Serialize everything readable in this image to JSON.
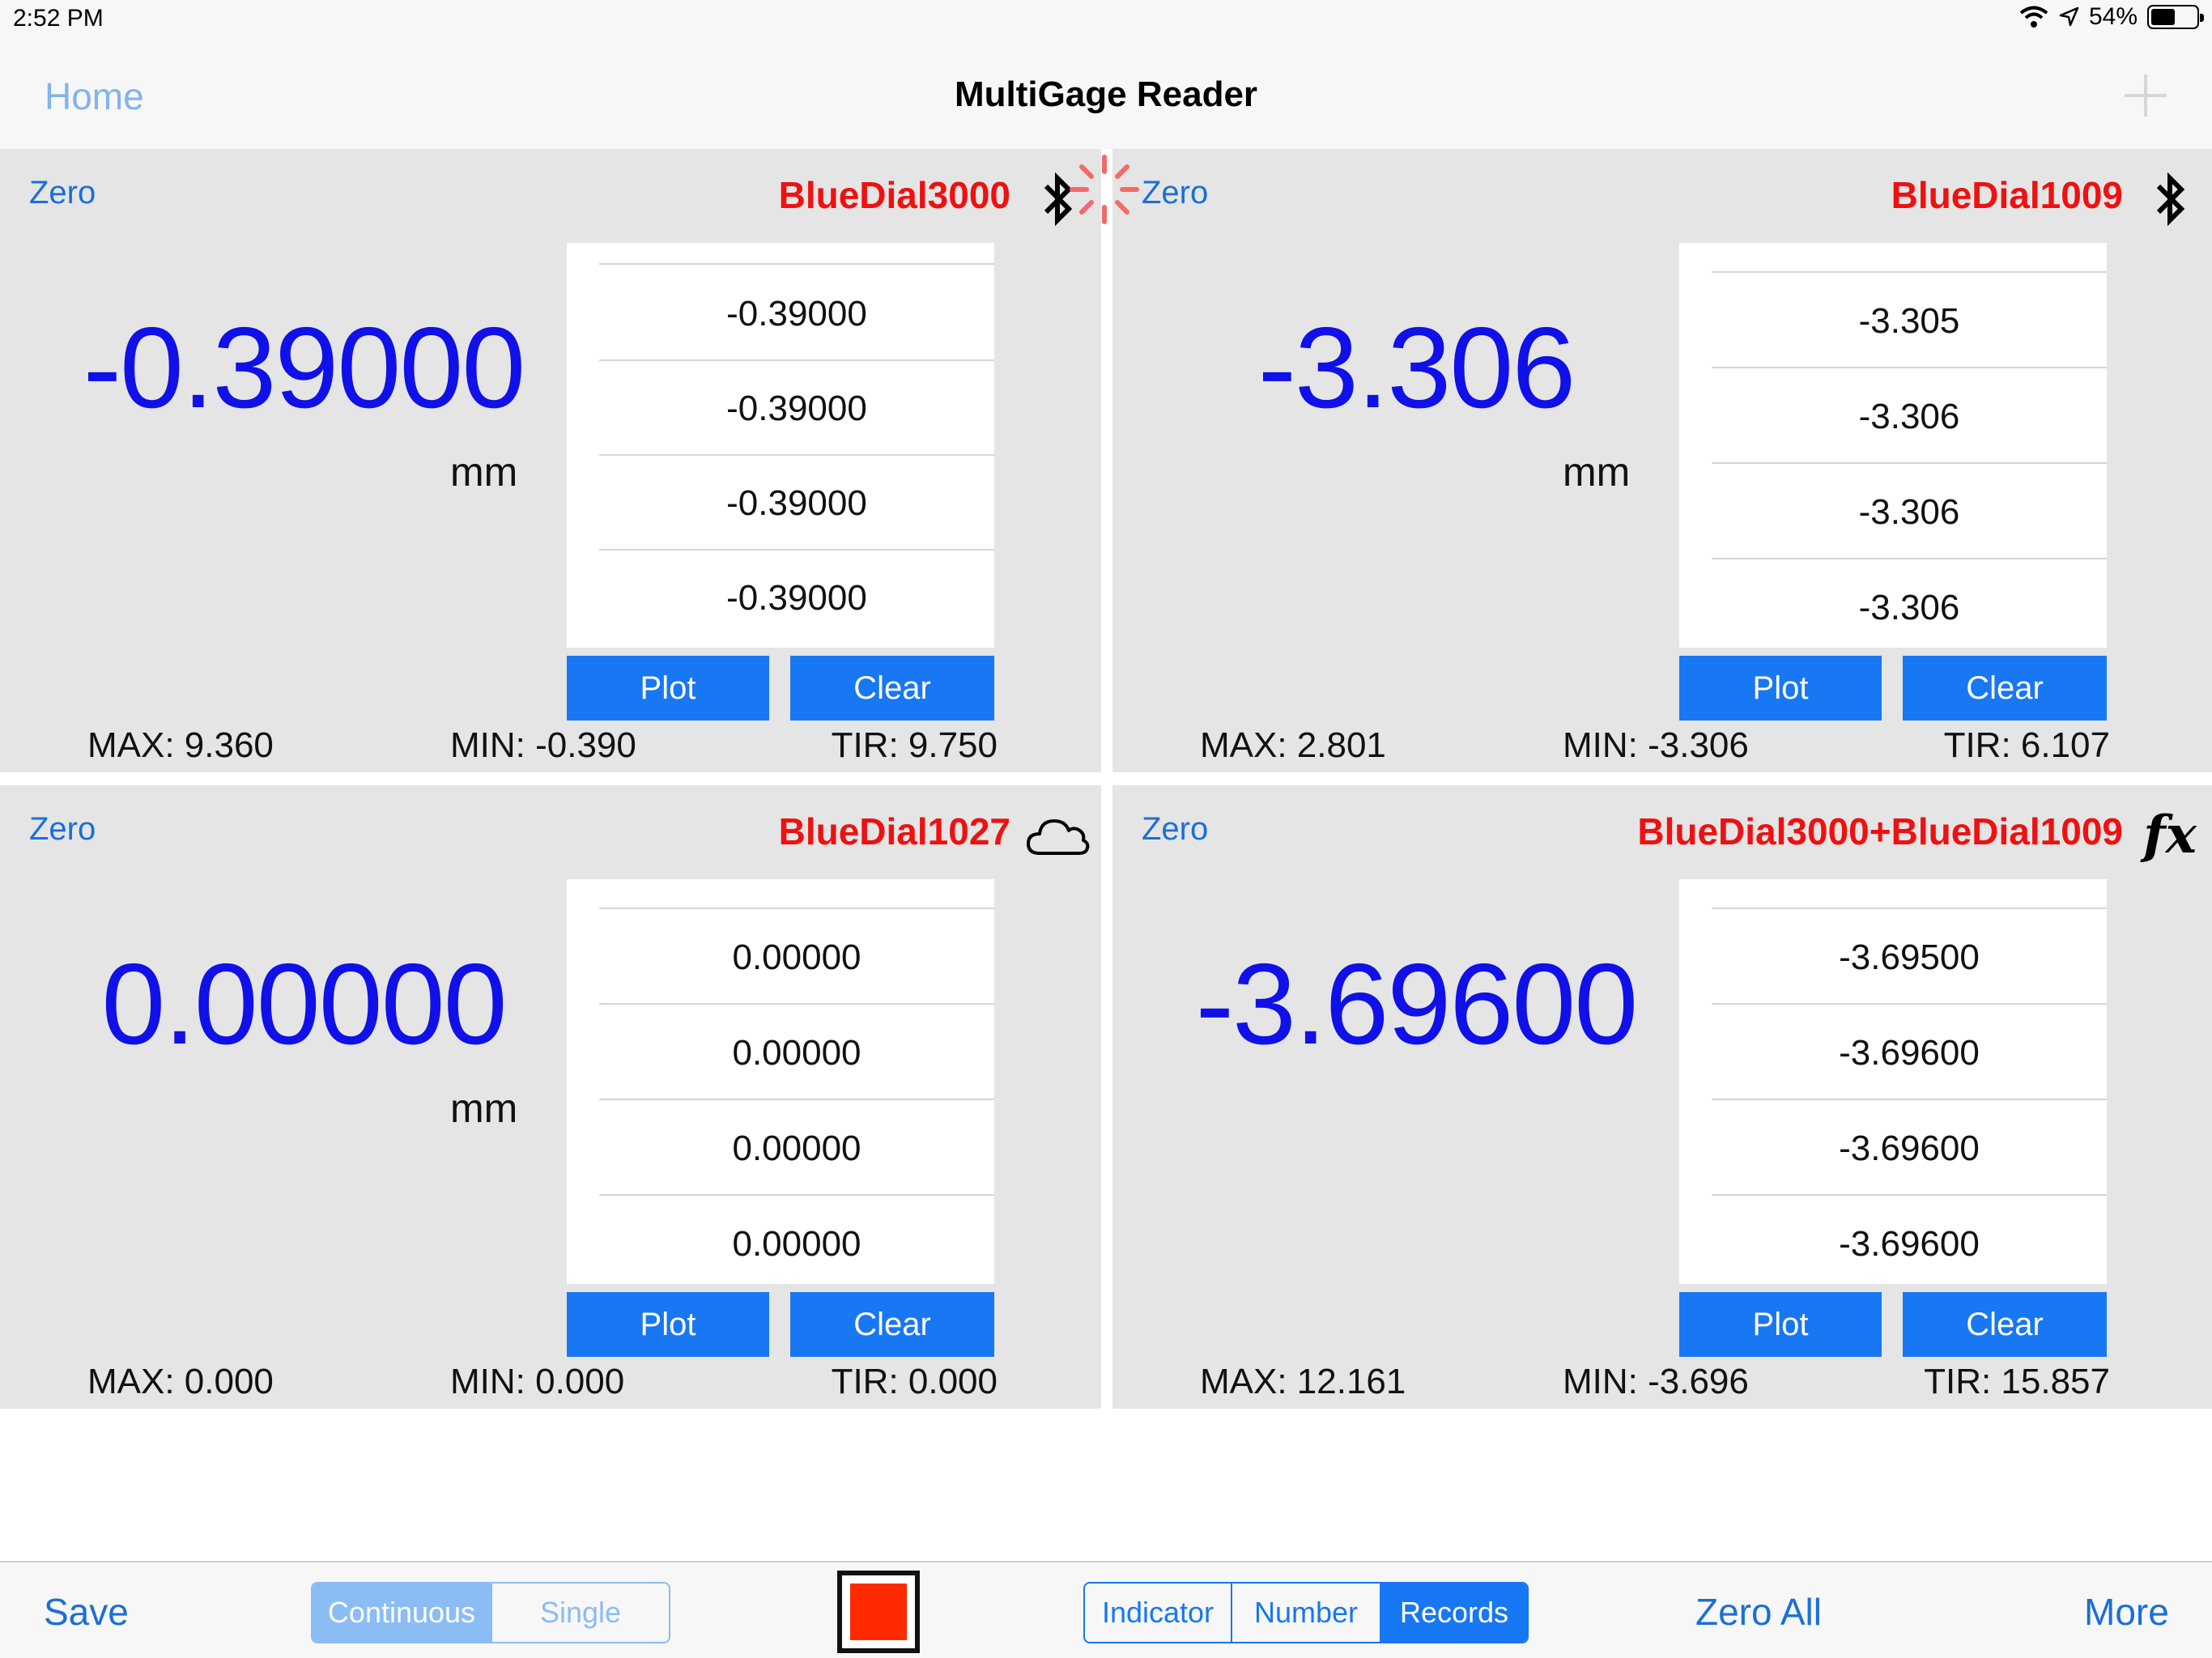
{
  "status_bar": {
    "time": "2:52 PM",
    "battery": "54%",
    "battery_level": 0.54
  },
  "nav": {
    "home": "Home",
    "title": "MultiGage Reader",
    "add_icon": "plus-icon"
  },
  "panels": [
    {
      "zero": "Zero",
      "device": "BlueDial3000",
      "icon": "bluetooth-icon",
      "value": "-0.39000",
      "unit": "mm",
      "records": [
        "-0.39000",
        "-0.39000",
        "-0.39000",
        "-0.39000"
      ],
      "plot": "Plot",
      "clear": "Clear",
      "max": "MAX: 9.360",
      "min": "MIN: -0.390",
      "tir": "TIR: 9.750"
    },
    {
      "zero": "Zero",
      "device": "BlueDial1009",
      "icon": "bluetooth-icon",
      "value": "-3.306",
      "unit": "mm",
      "records": [
        "-3.305",
        "-3.305",
        "-3.306",
        "-3.306",
        "-3.306"
      ],
      "plot": "Plot",
      "clear": "Clear",
      "max": "MAX: 2.801",
      "min": "MIN: -3.306",
      "tir": "TIR: 6.107"
    },
    {
      "zero": "Zero",
      "device": "BlueDial1027",
      "icon": "cloud-icon",
      "value": "0.00000",
      "unit": "mm",
      "records": [
        "0.00000",
        "0.00000",
        "0.00000",
        "0.00000",
        "0.00000"
      ],
      "plot": "Plot",
      "clear": "Clear",
      "max": "MAX: 0.000",
      "min": "MIN: 0.000",
      "tir": "TIR: 0.000"
    },
    {
      "zero": "Zero",
      "device": "BlueDial3000+BlueDial1009",
      "icon": "function-icon",
      "icon_text": "fx",
      "value": "-3.69600",
      "records": [
        "-3.69500",
        "-3.69500",
        "-3.69600",
        "-3.69600",
        "-3.69600"
      ],
      "plot": "Plot",
      "clear": "Clear",
      "max": "MAX: 12.161",
      "min": "MIN: -3.696",
      "tir": "TIR: 15.857"
    }
  ],
  "toolbar": {
    "save": "Save",
    "mode": {
      "options": [
        "Continuous",
        "Single"
      ],
      "selected": "Continuous"
    },
    "stop_icon": "stop-icon",
    "view": {
      "options": [
        "Indicator",
        "Number",
        "Records"
      ],
      "selected": "Records"
    },
    "zero_all": "Zero All",
    "more": "More"
  },
  "colors": {
    "accent": "#1877f2",
    "value_blue": "#1010e8",
    "device_red": "#ee1111",
    "panel_bg": "#e5e5e5",
    "stop_red": "#ff2a00"
  }
}
